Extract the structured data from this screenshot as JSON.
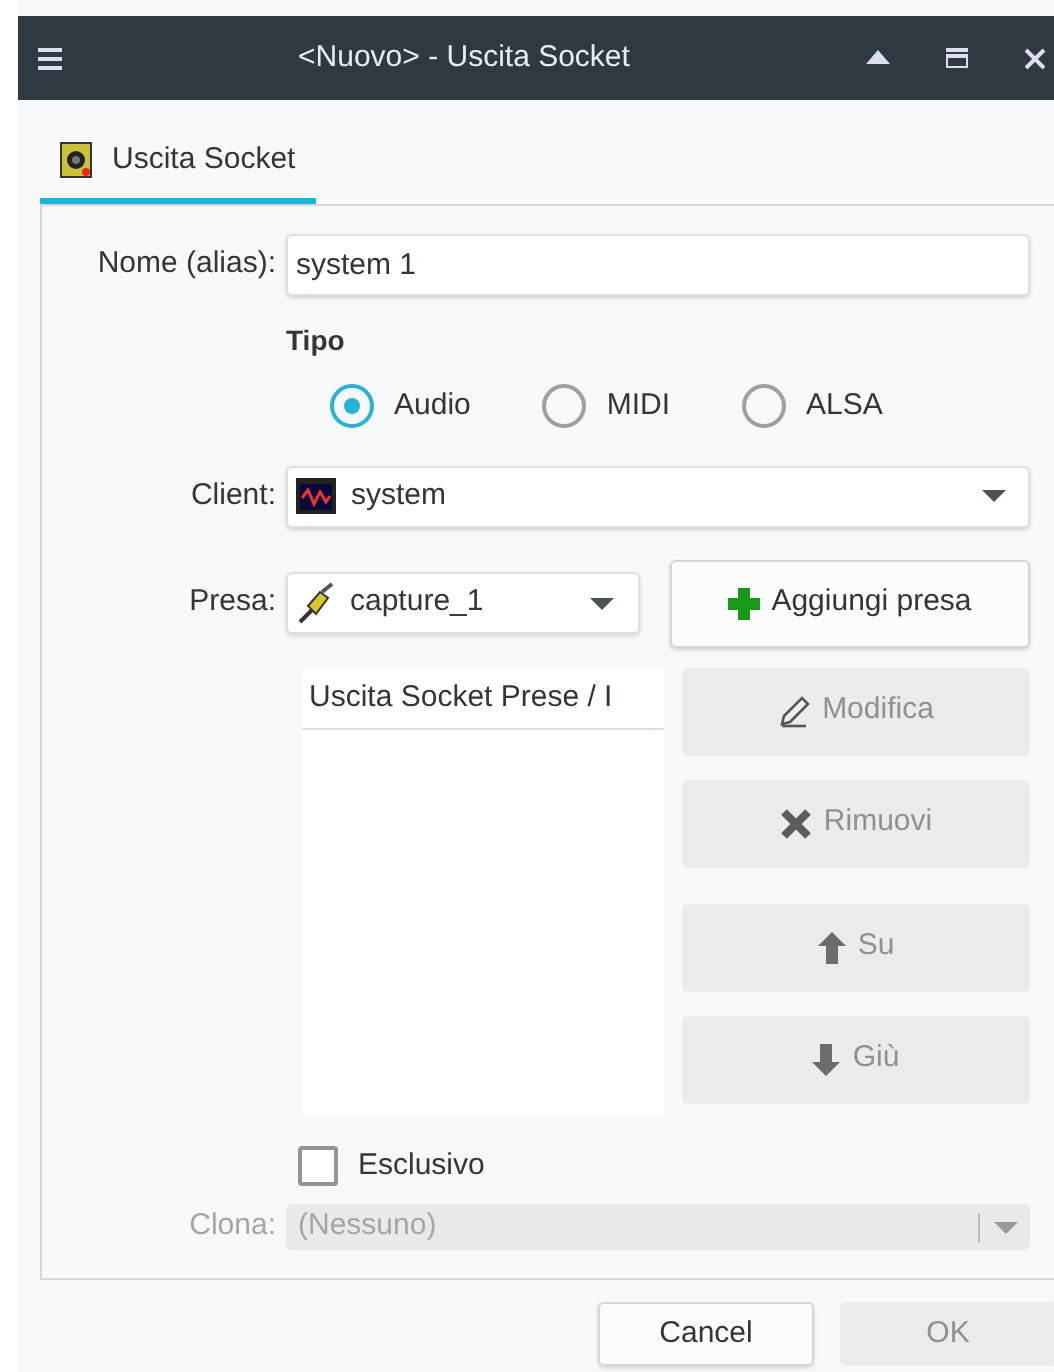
{
  "window": {
    "title": "<Nuovo> - Uscita Socket"
  },
  "tabs": [
    {
      "label": "Uscita Socket",
      "selected": true
    }
  ],
  "form": {
    "name_label": "Nome (alias):",
    "name_value": "system 1",
    "type_heading": "Tipo",
    "type_options": [
      {
        "label": "Audio",
        "selected": true
      },
      {
        "label": "MIDI",
        "selected": false
      },
      {
        "label": "ALSA",
        "selected": false
      }
    ],
    "client_label": "Client:",
    "client_value": "system",
    "plug_label": "Presa:",
    "plug_value": "capture_1",
    "list_header": "Uscita Socket Prese / I",
    "buttons": [
      {
        "label": "Aggiungi presa",
        "kind": "add",
        "disabled": false
      },
      {
        "label": "Modifica",
        "kind": "edit",
        "disabled": true
      },
      {
        "label": "Rimuovi",
        "kind": "remove",
        "disabled": true
      },
      {
        "label": "Su",
        "kind": "up",
        "disabled": true
      },
      {
        "label": "Giù",
        "kind": "down",
        "disabled": true
      }
    ],
    "exclusive": {
      "label": "Esclusivo",
      "checked": false
    },
    "clone": {
      "label": "Clona:",
      "value": "(Nessuno)",
      "disabled": true
    }
  },
  "dialog_buttons": [
    {
      "label": "Cancel",
      "disabled": false
    },
    {
      "label": "OK",
      "disabled": true
    }
  ]
}
